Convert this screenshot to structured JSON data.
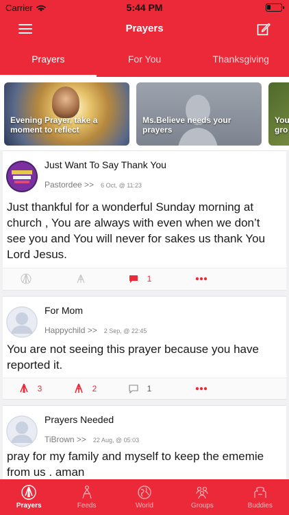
{
  "status_bar": {
    "carrier": "Carrier",
    "time": "5:44 PM"
  },
  "nav": {
    "title": "Prayers",
    "menu_icon": "menu-icon",
    "compose_icon": "compose-icon"
  },
  "tabs": [
    {
      "label": "Prayers",
      "active": true
    },
    {
      "label": "For You",
      "active": false
    },
    {
      "label": "Thanksgiving",
      "active": false
    }
  ],
  "carousel": [
    {
      "line1": "Evening Prayer, take a",
      "line2": "moment to reflect"
    },
    {
      "line1": "Ms.Believe needs your",
      "line2": "prayers"
    },
    {
      "line1": "You",
      "line2": "gro"
    }
  ],
  "posts": [
    {
      "title": "Just Want To Say Thank You",
      "user": "Pastordee >>",
      "date": "6 Oct, @ 11:23",
      "body": "Just thankful for a wonderful Sunday morning at church , You are always with even when we don’t see you and You will never for sakes us thank You Lord Jesus.",
      "pray_count": "",
      "hands_count": "",
      "comment_count": "1"
    },
    {
      "title": "For Mom",
      "user": "Happychild >>",
      "date": "2 Sep, @ 22:45",
      "body": "You are not seeing this prayer because you have reported it.",
      "pray_count": "3",
      "hands_count": "2",
      "comment_count": "1"
    },
    {
      "title": "Prayers Needed",
      "user": "TiBrown >>",
      "date": "22 Aug, @ 05:03",
      "body": "pray for my family and myself to keep the ememie from us . aman"
    }
  ],
  "tabbar": [
    {
      "label": "Prayers",
      "icon": "praying-hands-icon",
      "active": true
    },
    {
      "label": "Feeds",
      "icon": "person-praying-icon",
      "active": false
    },
    {
      "label": "World",
      "icon": "globe-icon",
      "active": false
    },
    {
      "label": "Groups",
      "icon": "group-icon",
      "active": false
    },
    {
      "label": "Buddies",
      "icon": "buddies-icon",
      "active": false
    }
  ],
  "colors": {
    "brand": "#ec2939",
    "background": "#f1f1f3"
  }
}
